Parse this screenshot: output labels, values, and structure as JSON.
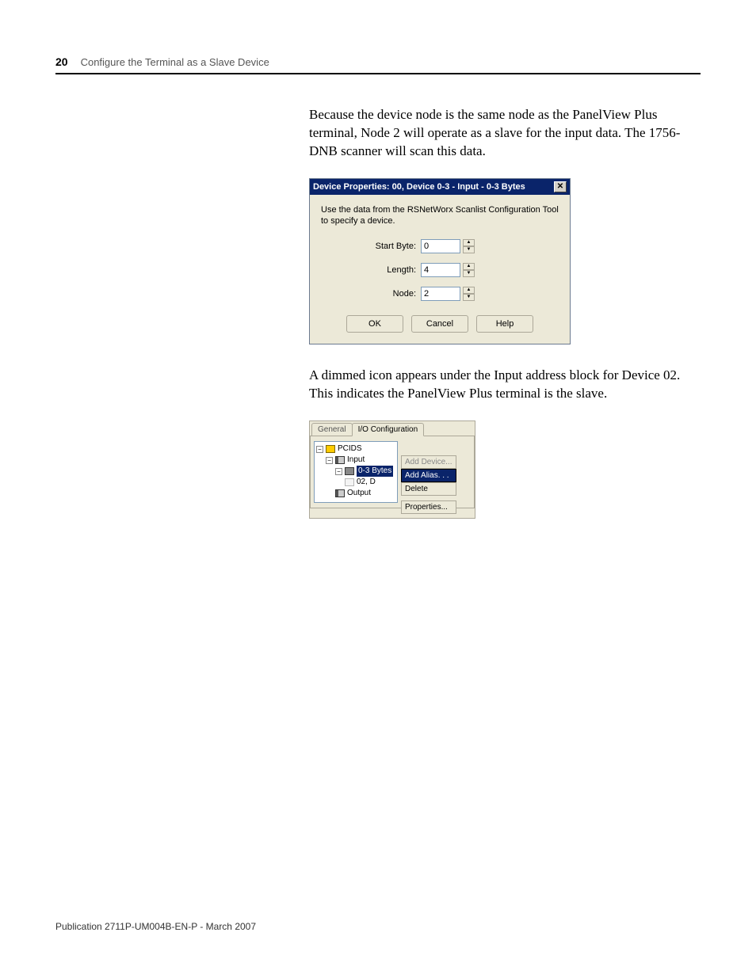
{
  "header": {
    "page_number": "20",
    "title": "Configure the Terminal as a Slave Device"
  },
  "paragraph1": "Because the device node is the same node as the PanelView Plus terminal, Node 2 will operate as a slave for the input data. The 1756-DNB scanner will scan this data.",
  "dialog1": {
    "title": "Device Properties: 00, Device 0-3 - Input - 0-3 Bytes",
    "close": "✕",
    "instruction": "Use the data from the RSNetWorx Scanlist Configuration Tool to specify a device.",
    "fields": {
      "start_byte": {
        "label": "Start Byte:",
        "value": "0"
      },
      "length": {
        "label": "Length:",
        "value": "4"
      },
      "node": {
        "label": "Node:",
        "value": "2"
      }
    },
    "buttons": {
      "ok": "OK",
      "cancel": "Cancel",
      "help": "Help"
    }
  },
  "paragraph2": "A dimmed icon appears under the Input address block for Device 02. This indicates the PanelView Plus terminal is the slave.",
  "dialog2": {
    "tabs": {
      "general": "General",
      "io": "I/O Configuration"
    },
    "tree": {
      "root": "PCIDS",
      "input": "Input",
      "bytes": "0-3 Bytes",
      "device": "02, D",
      "output": "Output"
    },
    "buttons": {
      "add_device": "Add Device...",
      "add_alias": "Add Alias. . .",
      "delete": "Delete",
      "properties": "Properties..."
    }
  },
  "footer": "Publication 2711P-UM004B-EN-P - March 2007"
}
